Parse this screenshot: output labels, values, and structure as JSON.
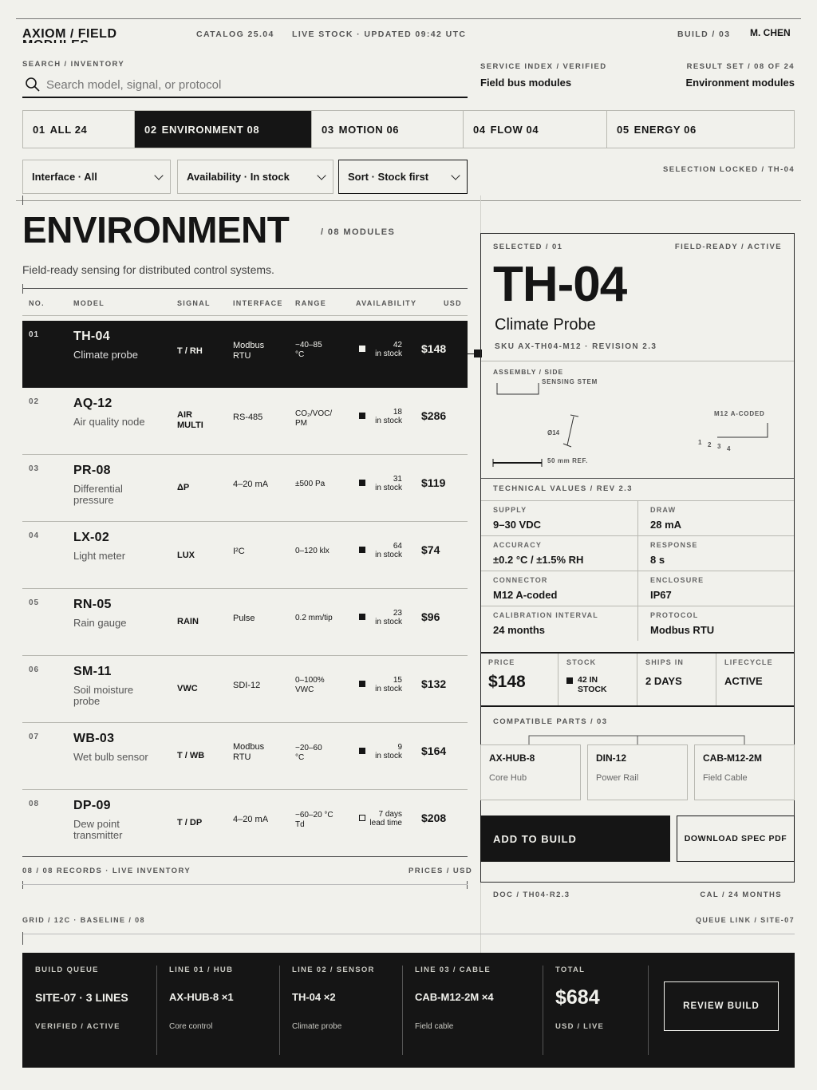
{
  "header": {
    "brand": "AXIOM / FIELD MODULES",
    "catalog": "CATALOG 25.04",
    "live": "LIVE STOCK · UPDATED 09:42 UTC",
    "build": "BUILD / 03",
    "user": "M. CHEN"
  },
  "search": {
    "label": "SEARCH / INVENTORY",
    "placeholder": "Search model, signal, or protocol"
  },
  "service_index": {
    "label": "SERVICE INDEX / VERIFIED",
    "value": "Field bus modules"
  },
  "result_set": {
    "label": "RESULT SET / 08 OF 24",
    "value": "Environment modules"
  },
  "tabs": [
    {
      "num": "01",
      "label": "ALL 24"
    },
    {
      "num": "02",
      "label": "ENVIRONMENT 08"
    },
    {
      "num": "03",
      "label": "MOTION 06"
    },
    {
      "num": "04",
      "label": "FLOW 04"
    },
    {
      "num": "05",
      "label": "ENERGY 06"
    }
  ],
  "filters": {
    "interface": "Interface · All",
    "availability": "Availability · In stock",
    "sort": "Sort · Stock first",
    "locked": "SELECTION LOCKED / TH-04"
  },
  "section": {
    "title": "ENVIRONMENT",
    "count": "/ 08 MODULES",
    "description": "Field-ready sensing for distributed control systems."
  },
  "table": {
    "headers": [
      "NO.",
      "MODEL",
      "SIGNAL",
      "INTERFACE",
      "RANGE",
      "AVAILABILITY",
      "USD"
    ],
    "rows": [
      {
        "no": "01",
        "model": "TH-04",
        "sub": "Climate probe",
        "signal": "T / RH",
        "interface": "Modbus RTU",
        "range": "−40–85 °C",
        "qty": "42",
        "stock": "in stock",
        "price": "$148"
      },
      {
        "no": "02",
        "model": "AQ-12",
        "sub": "Air quality node",
        "signal": "AIR MULTI",
        "interface": "RS-485",
        "range": "CO₂/VOC/ PM",
        "qty": "18",
        "stock": "in stock",
        "price": "$286"
      },
      {
        "no": "03",
        "model": "PR-08",
        "sub": "Differential pressure",
        "signal": "ΔP",
        "interface": "4–20 mA",
        "range": "±500 Pa",
        "qty": "31",
        "stock": "in stock",
        "price": "$119"
      },
      {
        "no": "04",
        "model": "LX-02",
        "sub": "Light meter",
        "signal": "LUX",
        "interface": "I²C",
        "range": "0–120 klx",
        "qty": "64",
        "stock": "in stock",
        "price": "$74"
      },
      {
        "no": "05",
        "model": "RN-05",
        "sub": "Rain gauge",
        "signal": "RAIN",
        "interface": "Pulse",
        "range": "0.2 mm/tip",
        "qty": "23",
        "stock": "in stock",
        "price": "$96"
      },
      {
        "no": "06",
        "model": "SM-11",
        "sub": "Soil moisture probe",
        "signal": "VWC",
        "interface": "SDI-12",
        "range": "0–100% VWC",
        "qty": "15",
        "stock": "in stock",
        "price": "$132"
      },
      {
        "no": "07",
        "model": "WB-03",
        "sub": "Wet bulb sensor",
        "signal": "T / WB",
        "interface": "Modbus RTU",
        "range": "−20–60 °C",
        "qty": "9",
        "stock": "in stock",
        "price": "$164"
      },
      {
        "no": "08",
        "model": "DP-09",
        "sub": "Dew point transmitter",
        "signal": "T / DP",
        "interface": "4–20 mA",
        "range": "−60–20 °C Td",
        "qty": "7 days",
        "stock": "lead time",
        "price": "$208"
      }
    ],
    "footer_left": "08 / 08 RECORDS · LIVE INVENTORY",
    "footer_right": "PRICES / USD"
  },
  "grid_note": "GRID / 12C · BASELINE / 08",
  "queue_note": "QUEUE LINK / SITE-07",
  "detail": {
    "selected": "SELECTED / 01",
    "status": "FIELD-READY / ACTIVE",
    "model": "TH-04",
    "name": "Climate Probe",
    "sku": "SKU AX-TH04-M12 · REVISION 2.3",
    "drawing": {
      "title": "ASSEMBLY / SIDE ELEVATION",
      "stem": "SENSING STEM",
      "dia": "Ø14",
      "scale": "50 mm REF.",
      "connector": "M12 A-CODED",
      "pins": [
        "1",
        "2",
        "3",
        "4"
      ]
    },
    "tech_title": "TECHNICAL VALUES / REV 2.3",
    "specs": [
      {
        "label": "SUPPLY",
        "value": "9–30 VDC"
      },
      {
        "label": "DRAW",
        "value": "28 mA"
      },
      {
        "label": "ACCURACY",
        "value": "±0.2 °C / ±1.5% RH"
      },
      {
        "label": "RESPONSE",
        "value": "8 s"
      },
      {
        "label": "CONNECTOR",
        "value": "M12 A-coded"
      },
      {
        "label": "ENCLOSURE",
        "value": "IP67"
      },
      {
        "label": "CALIBRATION INTERVAL",
        "value": "24 months"
      },
      {
        "label": "PROTOCOL",
        "value": "Modbus RTU"
      }
    ],
    "summary": {
      "price_label": "PRICE",
      "price": "$148",
      "stock_label": "STOCK",
      "stock": "42 IN STOCK",
      "ships_label": "SHIPS IN",
      "ships": "2 DAYS",
      "life_label": "LIFECYCLE",
      "life": "ACTIVE"
    },
    "compat_title": "COMPATIBLE PARTS / 03",
    "parts": [
      {
        "name": "AX-HUB-8",
        "desc": "Core Hub"
      },
      {
        "name": "DIN-12",
        "desc": "Power Rail"
      },
      {
        "name": "CAB-M12-2M",
        "desc": "Field Cable"
      }
    ],
    "add_button": "ADD TO BUILD",
    "download_button": "DOWNLOAD SPEC PDF",
    "doc": "DOC / TH04-R2.3",
    "cal": "CAL / 24 MONTHS"
  },
  "footer": {
    "queue_label": "BUILD QUEUE",
    "queue_value": "SITE-07 · 3 LINES",
    "queue_sub": "VERIFIED / ACTIVE",
    "lines": [
      {
        "label": "LINE 01 / HUB",
        "value": "AX-HUB-8 ×1",
        "sub": "Core control"
      },
      {
        "label": "LINE 02 / SENSOR",
        "value": "TH-04 ×2",
        "sub": "Climate probe"
      },
      {
        "label": "LINE 03 / CABLE",
        "value": "CAB-M12-2M ×4",
        "sub": "Field cable"
      }
    ],
    "total_label": "TOTAL",
    "total": "$684",
    "total_sub": "USD / LIVE",
    "review_button": "REVIEW BUILD"
  }
}
